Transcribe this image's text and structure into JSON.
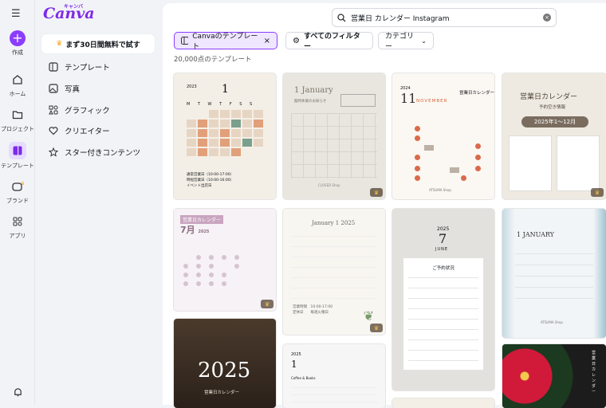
{
  "rail": {
    "create": "作成",
    "home": "ホーム",
    "project": "プロジェクト",
    "template": "テンプレート",
    "brand": "ブランド",
    "apps": "アプリ"
  },
  "logo": {
    "main": "Canva",
    "kana": "キャンバ"
  },
  "trial": "まず30日間無料で試す",
  "nav": {
    "templates": "テンプレート",
    "photos": "写真",
    "graphics": "グラフィック",
    "creator": "クリエイター",
    "starred": "スター付きコンテンツ"
  },
  "search": {
    "value": "営業日 カレンダー Instagram"
  },
  "chips": {
    "canva": "Canvaのテンプレート",
    "filters": "すべてのフィルター",
    "category": "カテゴリー"
  },
  "count": "20,000点のテンプレート",
  "cards": {
    "c1": {
      "year": "2023",
      "month": "1",
      "days": "M T W T F S S",
      "leg1": "通常営業日（10:00-17:00）",
      "leg2": "時短営業日（10:00-16:00）",
      "leg3": "イベント出店日"
    },
    "c2": {
      "title": "1 January",
      "sub": "臨時休業のお知らせ",
      "foot": "CLOSED Shop"
    },
    "c3": {
      "year": "2024",
      "month": "11",
      "mname": "NOVEMBER",
      "title": "営業日カレンダー",
      "foot": "ATSUMA Shop"
    },
    "c4": {
      "title": "営業日カレンダー",
      "sub": "予約空き情報",
      "band": "2025年1〜12月"
    },
    "c5": {
      "title": "営業日カレンダー",
      "month": "7月",
      "year": "2025"
    },
    "c6": {
      "month": "January 1 2025",
      "l1": "営業時間　10:00-17:00",
      "l2": "定休日　　毎週火曜日"
    },
    "c7": {
      "year": "2025",
      "month": "7",
      "mname": "JUNE",
      "title": "ご予約状況"
    },
    "c8": {
      "month": "1 JANUARY",
      "foot": "ATSUMA Shop"
    },
    "c9": {
      "year": "2025",
      "sub": "営業日カレンダー"
    },
    "c10": {
      "year": "2025",
      "month": "1",
      "sub": "Coffee & Books"
    },
    "c12": {
      "title": "営業日カレンダー"
    }
  }
}
